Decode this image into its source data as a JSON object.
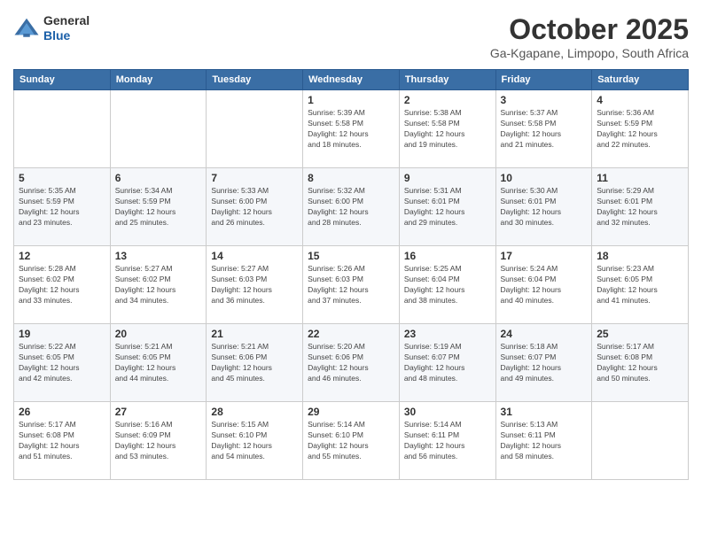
{
  "logo": {
    "general": "General",
    "blue": "Blue"
  },
  "header": {
    "month": "October 2025",
    "location": "Ga-Kgapane, Limpopo, South Africa"
  },
  "weekdays": [
    "Sunday",
    "Monday",
    "Tuesday",
    "Wednesday",
    "Thursday",
    "Friday",
    "Saturday"
  ],
  "weeks": [
    [
      {
        "day": "",
        "info": ""
      },
      {
        "day": "",
        "info": ""
      },
      {
        "day": "",
        "info": ""
      },
      {
        "day": "1",
        "info": "Sunrise: 5:39 AM\nSunset: 5:58 PM\nDaylight: 12 hours\nand 18 minutes."
      },
      {
        "day": "2",
        "info": "Sunrise: 5:38 AM\nSunset: 5:58 PM\nDaylight: 12 hours\nand 19 minutes."
      },
      {
        "day": "3",
        "info": "Sunrise: 5:37 AM\nSunset: 5:58 PM\nDaylight: 12 hours\nand 21 minutes."
      },
      {
        "day": "4",
        "info": "Sunrise: 5:36 AM\nSunset: 5:59 PM\nDaylight: 12 hours\nand 22 minutes."
      }
    ],
    [
      {
        "day": "5",
        "info": "Sunrise: 5:35 AM\nSunset: 5:59 PM\nDaylight: 12 hours\nand 23 minutes."
      },
      {
        "day": "6",
        "info": "Sunrise: 5:34 AM\nSunset: 5:59 PM\nDaylight: 12 hours\nand 25 minutes."
      },
      {
        "day": "7",
        "info": "Sunrise: 5:33 AM\nSunset: 6:00 PM\nDaylight: 12 hours\nand 26 minutes."
      },
      {
        "day": "8",
        "info": "Sunrise: 5:32 AM\nSunset: 6:00 PM\nDaylight: 12 hours\nand 28 minutes."
      },
      {
        "day": "9",
        "info": "Sunrise: 5:31 AM\nSunset: 6:01 PM\nDaylight: 12 hours\nand 29 minutes."
      },
      {
        "day": "10",
        "info": "Sunrise: 5:30 AM\nSunset: 6:01 PM\nDaylight: 12 hours\nand 30 minutes."
      },
      {
        "day": "11",
        "info": "Sunrise: 5:29 AM\nSunset: 6:01 PM\nDaylight: 12 hours\nand 32 minutes."
      }
    ],
    [
      {
        "day": "12",
        "info": "Sunrise: 5:28 AM\nSunset: 6:02 PM\nDaylight: 12 hours\nand 33 minutes."
      },
      {
        "day": "13",
        "info": "Sunrise: 5:27 AM\nSunset: 6:02 PM\nDaylight: 12 hours\nand 34 minutes."
      },
      {
        "day": "14",
        "info": "Sunrise: 5:27 AM\nSunset: 6:03 PM\nDaylight: 12 hours\nand 36 minutes."
      },
      {
        "day": "15",
        "info": "Sunrise: 5:26 AM\nSunset: 6:03 PM\nDaylight: 12 hours\nand 37 minutes."
      },
      {
        "day": "16",
        "info": "Sunrise: 5:25 AM\nSunset: 6:04 PM\nDaylight: 12 hours\nand 38 minutes."
      },
      {
        "day": "17",
        "info": "Sunrise: 5:24 AM\nSunset: 6:04 PM\nDaylight: 12 hours\nand 40 minutes."
      },
      {
        "day": "18",
        "info": "Sunrise: 5:23 AM\nSunset: 6:05 PM\nDaylight: 12 hours\nand 41 minutes."
      }
    ],
    [
      {
        "day": "19",
        "info": "Sunrise: 5:22 AM\nSunset: 6:05 PM\nDaylight: 12 hours\nand 42 minutes."
      },
      {
        "day": "20",
        "info": "Sunrise: 5:21 AM\nSunset: 6:05 PM\nDaylight: 12 hours\nand 44 minutes."
      },
      {
        "day": "21",
        "info": "Sunrise: 5:21 AM\nSunset: 6:06 PM\nDaylight: 12 hours\nand 45 minutes."
      },
      {
        "day": "22",
        "info": "Sunrise: 5:20 AM\nSunset: 6:06 PM\nDaylight: 12 hours\nand 46 minutes."
      },
      {
        "day": "23",
        "info": "Sunrise: 5:19 AM\nSunset: 6:07 PM\nDaylight: 12 hours\nand 48 minutes."
      },
      {
        "day": "24",
        "info": "Sunrise: 5:18 AM\nSunset: 6:07 PM\nDaylight: 12 hours\nand 49 minutes."
      },
      {
        "day": "25",
        "info": "Sunrise: 5:17 AM\nSunset: 6:08 PM\nDaylight: 12 hours\nand 50 minutes."
      }
    ],
    [
      {
        "day": "26",
        "info": "Sunrise: 5:17 AM\nSunset: 6:08 PM\nDaylight: 12 hours\nand 51 minutes."
      },
      {
        "day": "27",
        "info": "Sunrise: 5:16 AM\nSunset: 6:09 PM\nDaylight: 12 hours\nand 53 minutes."
      },
      {
        "day": "28",
        "info": "Sunrise: 5:15 AM\nSunset: 6:10 PM\nDaylight: 12 hours\nand 54 minutes."
      },
      {
        "day": "29",
        "info": "Sunrise: 5:14 AM\nSunset: 6:10 PM\nDaylight: 12 hours\nand 55 minutes."
      },
      {
        "day": "30",
        "info": "Sunrise: 5:14 AM\nSunset: 6:11 PM\nDaylight: 12 hours\nand 56 minutes."
      },
      {
        "day": "31",
        "info": "Sunrise: 5:13 AM\nSunset: 6:11 PM\nDaylight: 12 hours\nand 58 minutes."
      },
      {
        "day": "",
        "info": ""
      }
    ]
  ]
}
